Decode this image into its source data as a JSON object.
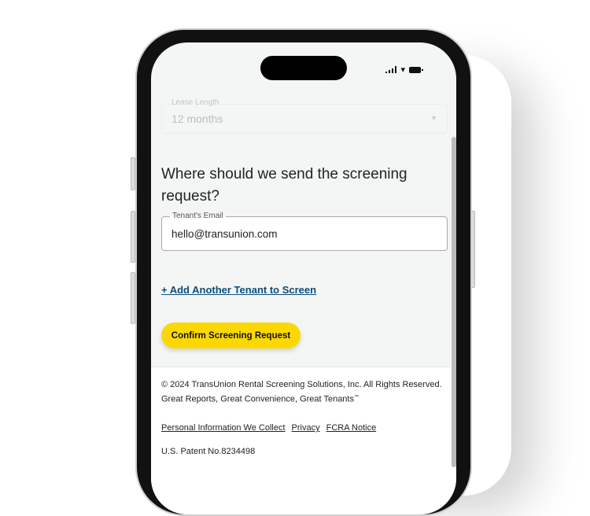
{
  "lease": {
    "label": "Lease Length",
    "value": "12 months"
  },
  "heading": "Where should we send the screening request?",
  "email": {
    "label": "Tenant's Email",
    "value": "hello@transunion.com"
  },
  "add_tenant": "+ Add Another Tenant to Screen",
  "confirm": "Confirm Screening Request",
  "footer": {
    "copyright": "© 2024 TransUnion Rental Screening Solutions, Inc. All Rights Reserved.",
    "tagline": "Great Reports, Great Convenience, Great Tenants",
    "tm": "™",
    "links": [
      "Personal Information We Collect",
      "Privacy",
      "FCRA Notice"
    ],
    "patent": "U.S. Patent No.8234498"
  },
  "colors": {
    "accent": "#fcd800",
    "link": "#0c4d7a"
  }
}
